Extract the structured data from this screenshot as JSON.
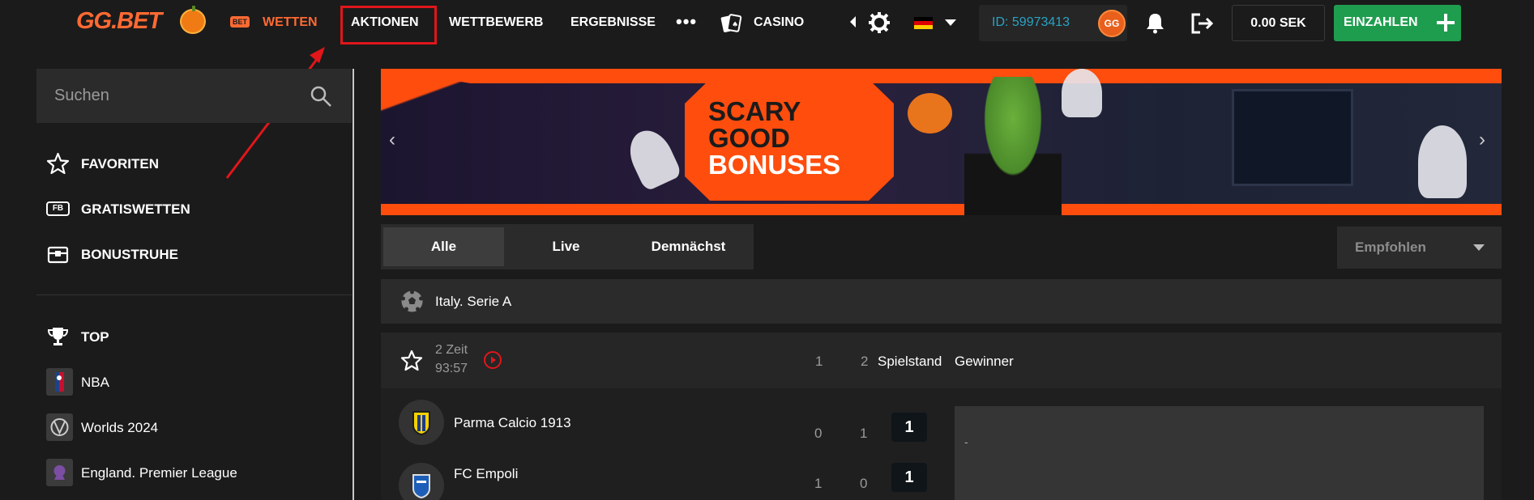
{
  "header": {
    "logo": "GG.BET",
    "bet_badge": "BET",
    "nav": {
      "wetten": "WETTEN",
      "aktionen": "AKTIONEN",
      "wettbewerb": "WETTBEWERB",
      "ergebnisse": "ERGEBNISSE",
      "more": "•••",
      "casino": "CASINO"
    },
    "user_id": "ID: 59973413",
    "avatar_text": "GG",
    "balance": "0.00 SEK",
    "deposit_label": "EINZAHLEN",
    "colors": {
      "accent": "#ff6a33",
      "deposit": "#1f9d4f",
      "highlight_box": "#e0161b",
      "id_text": "#2aa3c4"
    }
  },
  "sidebar": {
    "search_placeholder": "Suchen",
    "quick_items": [
      {
        "label": "FAVORITEN",
        "icon": "star-icon"
      },
      {
        "label": "GRATISWETTEN",
        "icon": "fb-icon",
        "icon_text": "FB"
      },
      {
        "label": "BONUSTRUHE",
        "icon": "treasure-chest-icon"
      }
    ],
    "sports_items": [
      {
        "label": "TOP",
        "icon": "trophy-icon"
      },
      {
        "label": "NBA",
        "icon": "nba-logo-icon"
      },
      {
        "label": "Worlds 2024",
        "icon": "worlds-logo-icon"
      },
      {
        "label": "England. Premier League",
        "icon": "premier-league-logo-icon"
      }
    ]
  },
  "banner": {
    "line1": "SCARY",
    "line2": "GOOD",
    "line3": "BONUSES",
    "prev": "‹",
    "next": "›"
  },
  "filters": {
    "tabs": [
      "Alle",
      "Live",
      "Demnächst"
    ],
    "active_tab": "Alle",
    "sort_selected": "Empfohlen"
  },
  "league": {
    "name": "Italy. Serie A",
    "icon": "soccer-ball-icon"
  },
  "match": {
    "period": "2 Zeit",
    "clock": "93:57",
    "col_1": "1",
    "col_2": "2",
    "col_score": "Spielstand",
    "col_winner": "Gewinner",
    "teams": [
      {
        "name": "Parma Calcio 1913",
        "p1": "0",
        "p2": "1",
        "score": "1",
        "odds": "-"
      },
      {
        "name": "FC Empoli",
        "p1": "1",
        "p2": "0",
        "score": "1",
        "odds": ""
      }
    ]
  }
}
